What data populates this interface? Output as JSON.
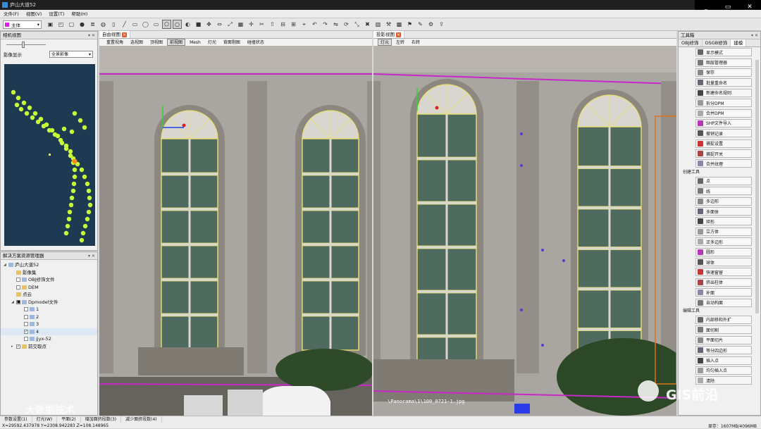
{
  "window": {
    "title": "庐山大道52",
    "ctl_restore": "▭",
    "ctl_close": "✕"
  },
  "menu": [
    "文件(F)",
    "视图(V)",
    "设置(T)",
    "帮助(H)"
  ],
  "toolbar": {
    "layer_select": "主体",
    "layer_color": "#e020e0"
  },
  "left_top": {
    "title": "相机视图",
    "label_display": "影像显示",
    "display_value": "全景影像"
  },
  "left_tree": {
    "title": "解决方案资源管理器",
    "items": [
      {
        "label": "庐山大道52",
        "depth": 0,
        "kind": "layer",
        "check": ""
      },
      {
        "label": "影像集",
        "depth": 1,
        "kind": "folder",
        "check": ""
      },
      {
        "label": "OBJ修饰文件",
        "depth": 1,
        "kind": "none",
        "check": " "
      },
      {
        "label": "DEM",
        "depth": 1,
        "kind": "folder",
        "check": " "
      },
      {
        "label": "点云",
        "depth": 1,
        "kind": "folder",
        "check": ""
      },
      {
        "label": "Dpmodel文件",
        "depth": 1,
        "kind": "layer",
        "check": "■"
      },
      {
        "label": "1",
        "depth": 2,
        "kind": "layer",
        "check": " "
      },
      {
        "label": "2",
        "depth": 2,
        "kind": "layer",
        "check": " "
      },
      {
        "label": "3",
        "depth": 2,
        "kind": "layer",
        "check": " "
      },
      {
        "label": "4",
        "depth": 2,
        "kind": "layer",
        "check": "✓"
      },
      {
        "label": "jjyx-52",
        "depth": 2,
        "kind": "layer",
        "check": " "
      },
      {
        "label": "前交取点",
        "depth": 1,
        "kind": "folder",
        "check": "✓"
      }
    ]
  },
  "free_view": {
    "tab": "自由视图",
    "subtabs": [
      "重置视角",
      "选视图",
      "顶视图",
      "前视图",
      "Mesh",
      "灯光",
      "背面剔图",
      "碰撞状态"
    ]
  },
  "proj_view": {
    "tab": "投影视图",
    "subtabs": [
      "灯元",
      "左转",
      "右转"
    ],
    "overlay_path": "\\Panorama\\1\\100_0721-1.jpg"
  },
  "toolbox": {
    "title": "工具箱",
    "tabs": [
      "OBJ修饰",
      "OSGB修饰",
      "建模"
    ],
    "top_tools": [
      "显示模式",
      "图层管理器",
      "保存",
      "批量重命名",
      "新建命名规则",
      "拆分DPM",
      "合并DPM",
      "SHP文件导入",
      "撤销记录",
      "捕捉设置",
      "捕捉开关",
      "合并纹理"
    ],
    "section_create": "创建工具",
    "create_tools": [
      "点",
      "线",
      "多边形",
      "多面体",
      "矩形",
      "立方体",
      "正多边形",
      "圆形",
      "球体",
      "快速窗留",
      "挤出柱体",
      "补面",
      "自动构面"
    ],
    "section_edit": "编辑工具",
    "edit_tools": [
      "内部移和外扩",
      "面切割",
      "平面切片",
      "等分四边形",
      "插入点",
      "均匀插入点",
      "清除"
    ]
  },
  "status": {
    "tabs": [
      "参数设置(1)",
      "灯光(W)",
      "平面(2)",
      "增加面挤段数(3)",
      "减少面挤段数(4)"
    ],
    "coords": "X=29592.437978  Y=2308.942283  Z=108.148965",
    "memory": "显存：1607MB/4096MB"
  },
  "watermarks": {
    "left": "大数据技术",
    "right": "GIS前沿"
  }
}
